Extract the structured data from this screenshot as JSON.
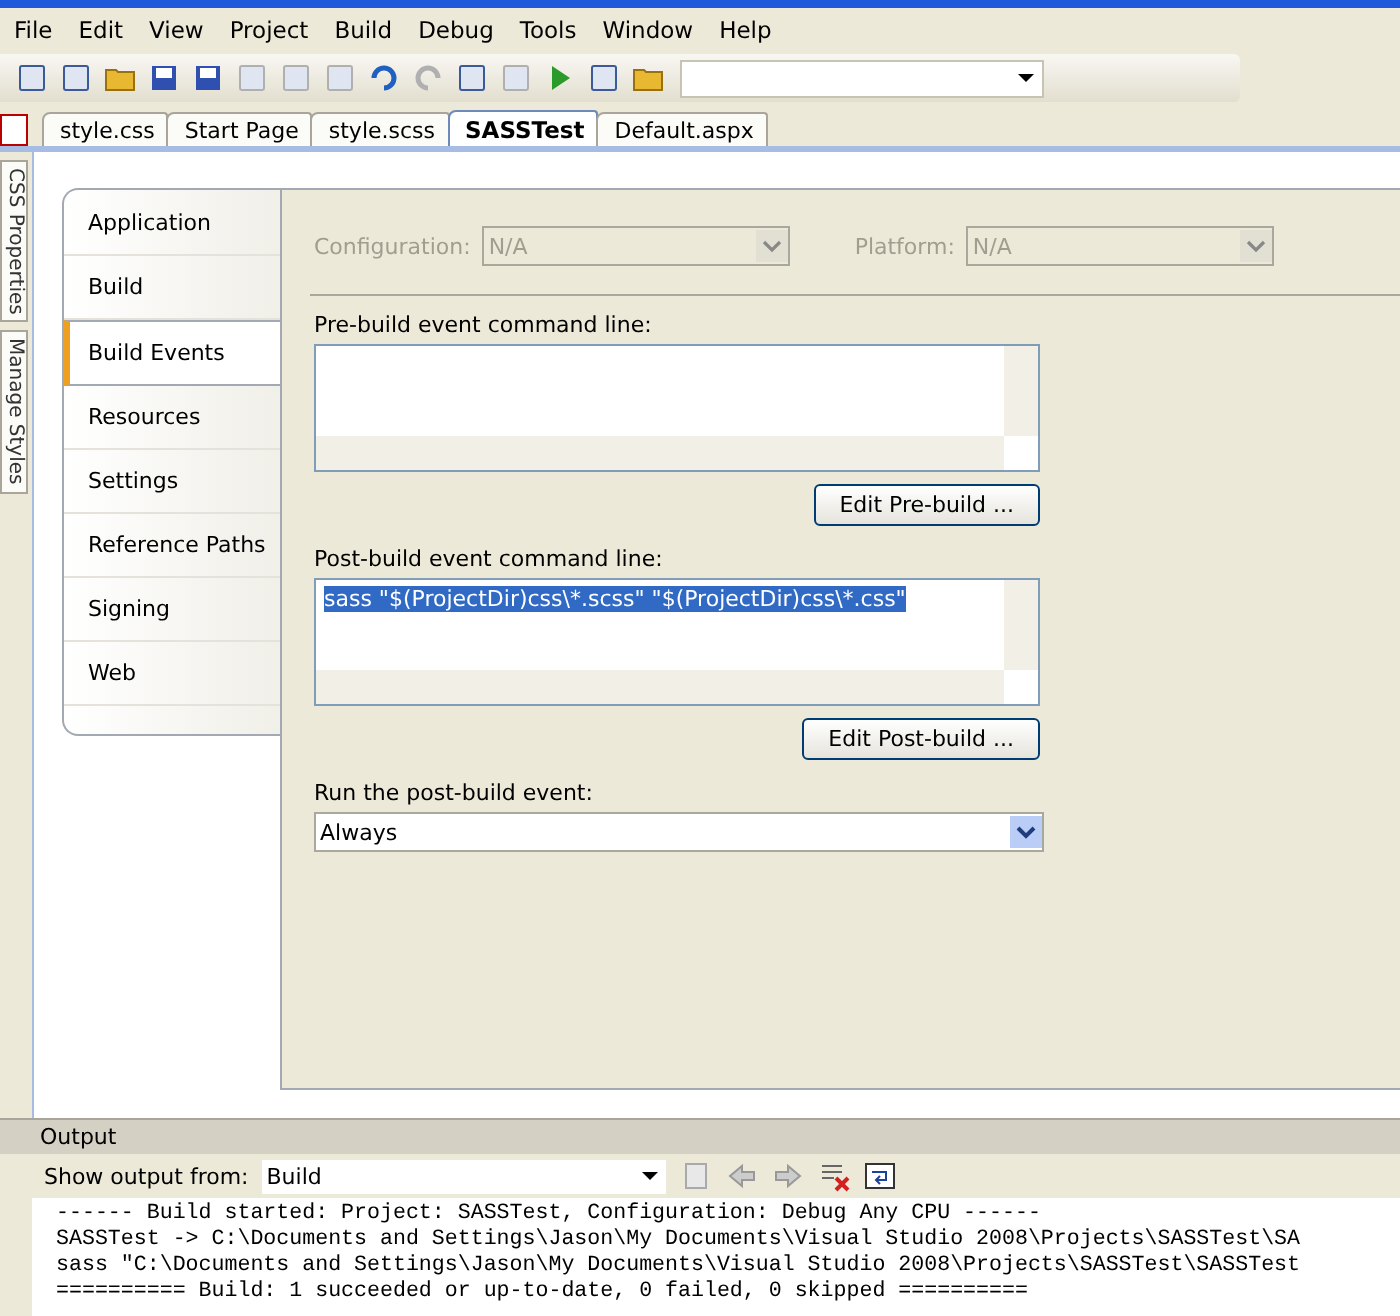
{
  "menu": [
    "File",
    "Edit",
    "View",
    "Project",
    "Build",
    "Debug",
    "Tools",
    "Window",
    "Help"
  ],
  "doc_tabs": [
    {
      "label": "style.css",
      "selected": false
    },
    {
      "label": "Start Page",
      "selected": false
    },
    {
      "label": "style.scss",
      "selected": false
    },
    {
      "label": "SASSTest",
      "selected": true
    },
    {
      "label": "Default.aspx",
      "selected": false
    }
  ],
  "side_tabs": [
    "CSS Properties",
    "Manage Styles"
  ],
  "nav": [
    {
      "label": "Application",
      "selected": false
    },
    {
      "label": "Build",
      "selected": false
    },
    {
      "label": "Build Events",
      "selected": true
    },
    {
      "label": "Resources",
      "selected": false
    },
    {
      "label": "Settings",
      "selected": false
    },
    {
      "label": "Reference Paths",
      "selected": false
    },
    {
      "label": "Signing",
      "selected": false
    },
    {
      "label": "Web",
      "selected": false
    }
  ],
  "configuration": {
    "label": "Configuration:",
    "value": "N/A",
    "disabled": true
  },
  "platform": {
    "label": "Platform:",
    "value": "N/A",
    "disabled": true
  },
  "pre_build": {
    "label": "Pre-build event command line:",
    "button": "Edit Pre-build ..."
  },
  "post_build": {
    "label": "Post-build event command line:",
    "value": "sass \"$(ProjectDir)css\\*.scss\" \"$(ProjectDir)css\\*.css\"",
    "selected": true,
    "button": "Edit Post-build ..."
  },
  "run_event": {
    "label": "Run the post-build event:",
    "value": "Always"
  },
  "output": {
    "title": "Output",
    "show_label": "Show output from:",
    "source": "Build",
    "lines": [
      "------ Build started: Project: SASSTest, Configuration: Debug Any CPU ------",
      "SASSTest -> C:\\Documents and Settings\\Jason\\My Documents\\Visual Studio 2008\\Projects\\SASSTest\\SA",
      "sass \"C:\\Documents and Settings\\Jason\\My Documents\\Visual Studio 2008\\Projects\\SASSTest\\SASSTest",
      "========== Build: 1 succeeded or up-to-date, 0 failed, 0 skipped =========="
    ]
  }
}
